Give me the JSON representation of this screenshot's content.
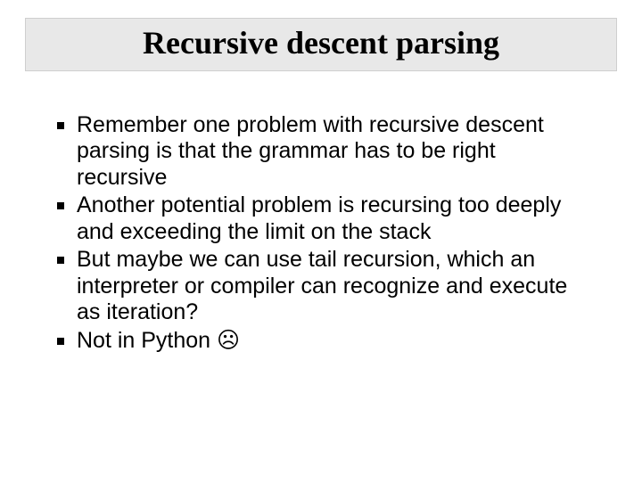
{
  "slide": {
    "title": "Recursive descent parsing",
    "bullets": [
      "Remember one problem with recursive descent parsing is that the grammar has to be right recursive",
      "Another potential problem is recursing too deeply and exceeding the limit on the stack",
      "But maybe we can use tail recursion, which an interpreter or compiler can recognize and execute as iteration?",
      "Not in Python ☹"
    ]
  }
}
